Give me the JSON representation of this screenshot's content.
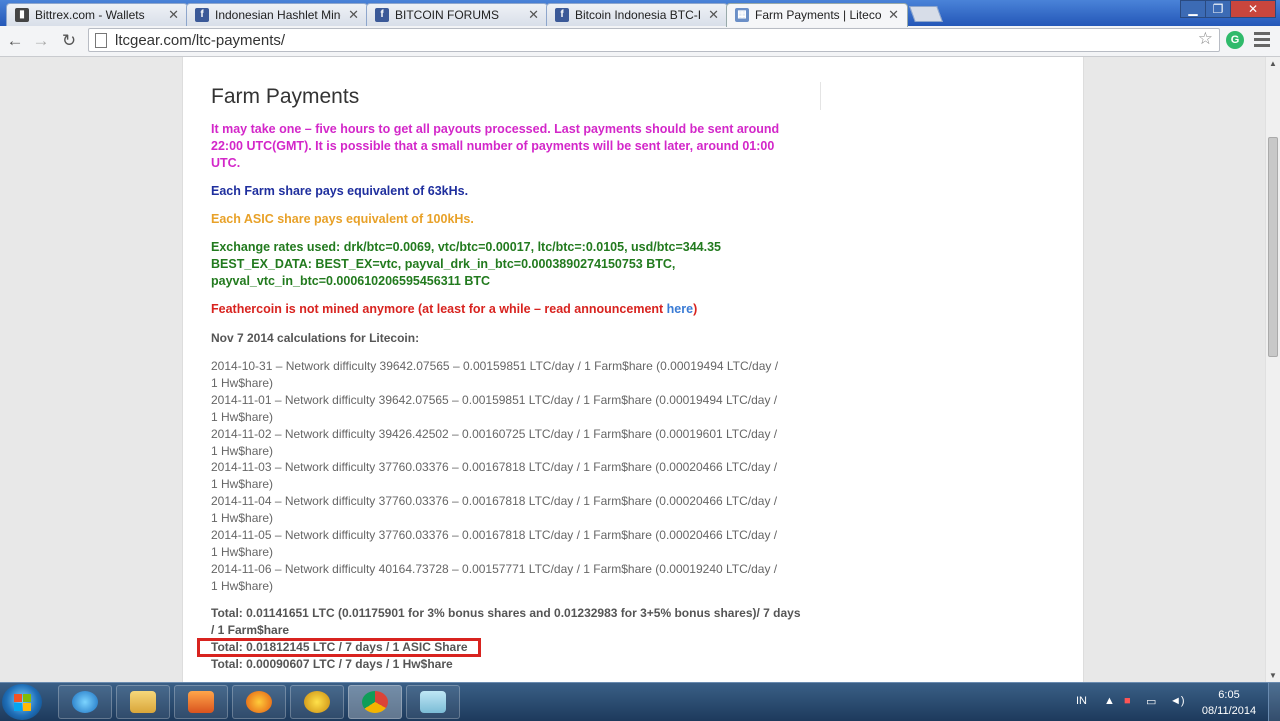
{
  "browser": {
    "tabs": [
      {
        "title": "Bittrex.com - Wallets",
        "favicon": "chart-favicon-icon"
      },
      {
        "title": "Indonesian Hashlet Miner",
        "favicon": "facebook-favicon-icon"
      },
      {
        "title": "BITCOIN FORUMS",
        "favicon": "facebook-favicon-icon"
      },
      {
        "title": "Bitcoin Indonesia BTC-Ind",
        "favicon": "facebook-favicon-icon"
      },
      {
        "title": "Farm Payments | Litecoin",
        "favicon": "ltcgear-favicon-icon"
      }
    ],
    "url": "ltcgear.com/ltc-payments/"
  },
  "page": {
    "title": "Farm Payments",
    "notice_payout": "It may take one – five hours to get all payouts processed. Last payments should be sent around 22:00 UTC(GMT). It is possible that a small number of payments will be sent later, around 01:00 UTC.",
    "farm_share": "Each Farm share pays equivalent of 63kHs.",
    "asic_share": "Each ASIC share pays equivalent of 100kHs.",
    "exchange_rates": "Exchange rates used: drk/btc=0.0069, vtc/btc=0.00017, ltc/btc=:0.0105, usd/btc=344.35 BEST_EX_DATA: BEST_EX=vtc, payval_drk_in_btc=0.0003890274150753 BTC, payval_vtc_in_btc=0.000610206595456311 BTC",
    "feathercoin_text": "Feathercoin is not mined anymore (at least for a while – read announcement ",
    "feathercoin_link": "here",
    "feathercoin_end": ")",
    "calc_heading": "Nov 7 2014 calculations for Litecoin:",
    "calculations": [
      "2014-10-31 – Network difficulty 39642.07565 – 0.00159851 LTC/day / 1 Farm$hare (0.00019494 LTC/day / 1 Hw$hare)",
      "2014-11-01 – Network difficulty 39642.07565 – 0.00159851 LTC/day / 1 Farm$hare (0.00019494 LTC/day / 1 Hw$hare)",
      "2014-11-02 – Network difficulty 39426.42502 – 0.00160725 LTC/day / 1 Farm$hare (0.00019601 LTC/day / 1 Hw$hare)",
      "2014-11-03 – Network difficulty 37760.03376 – 0.00167818 LTC/day / 1 Farm$hare (0.00020466 LTC/day / 1 Hw$hare)",
      "2014-11-04 – Network difficulty 37760.03376 – 0.00167818 LTC/day / 1 Farm$hare (0.00020466 LTC/day / 1 Hw$hare)",
      "2014-11-05 – Network difficulty 37760.03376 – 0.00167818 LTC/day / 1 Farm$hare (0.00020466 LTC/day / 1 Hw$hare)",
      "2014-11-06 – Network difficulty 40164.73728 – 0.00157771 LTC/day / 1 Farm$hare (0.00019240 LTC/day / 1 Hw$hare)"
    ],
    "total_farm": "Total: 0.01141651 LTC (0.01175901 for 3% bonus shares and 0.01232983 for 3+5% bonus shares)/ 7 days / 1 Farm$hare",
    "total_asic": "Total: 0.01812145 LTC / 7 days / 1 ASIC Share",
    "total_hw": "Total: 0.00090607 LTC / 7 days / 1 Hw$hare"
  },
  "colors": {
    "payout_notice": "#d327c9",
    "farm_share": "#1f2f9e",
    "asic_share": "#e8a128",
    "exchange_rates": "#227a1e",
    "feathercoin": "#d8231f",
    "highlight_box": "#d8231f"
  },
  "taskbar": {
    "items": [
      "internet-explorer-icon",
      "file-explorer-icon",
      "media-player-icon",
      "firefox-icon",
      "game-app-icon",
      "chrome-icon",
      "notepad-icon"
    ],
    "language": "IN",
    "time": "6:05",
    "date": "08/11/2014"
  }
}
